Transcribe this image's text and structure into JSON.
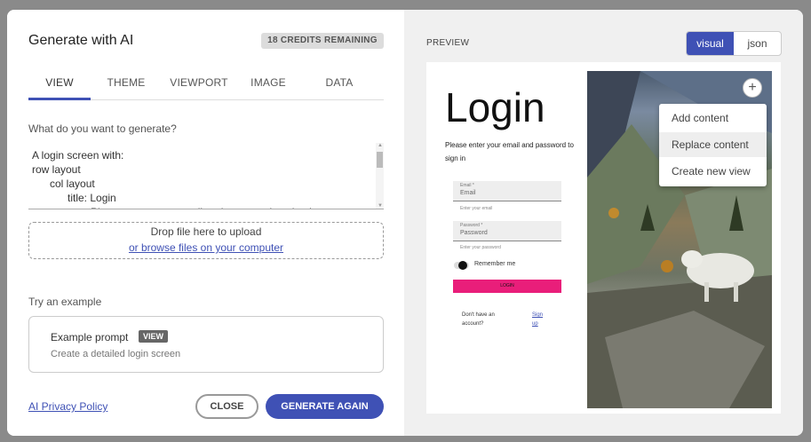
{
  "dialog": {
    "title": "Generate with AI",
    "credits": "18 CREDITS REMAINING",
    "tabs": [
      {
        "label": "VIEW"
      },
      {
        "label": "THEME"
      },
      {
        "label": "VIEWPORT"
      },
      {
        "label": "IMAGE"
      },
      {
        "label": "DATA"
      }
    ],
    "active_tab": "VIEW",
    "prompt_label": "What do you want to generate?",
    "prompt_value": "A login screen with:\nrow layout\n      col layout\n            title: Login\n            text: Please enter your email and password to sign in",
    "dropzone_text": "Drop file here to upload",
    "browse_link": "or browse files on your computer",
    "example_label": "Try an example",
    "example_title": "Example prompt",
    "example_badge": "VIEW",
    "example_desc": "Create a detailed login screen",
    "privacy_link": "AI Privacy Policy",
    "close_label": "CLOSE",
    "generate_label": "GENERATE AGAIN"
  },
  "preview": {
    "label": "PREVIEW",
    "toggle": [
      "visual",
      "json"
    ],
    "active_toggle": "visual",
    "login": {
      "heading": "Login",
      "subtitle": "Please enter your email and password to sign in",
      "email_label": "Email *",
      "email_placeholder": "Email",
      "email_hint": "Enter your email",
      "password_label": "Password *",
      "password_placeholder": "Password",
      "password_hint": "Enter your password",
      "remember": "Remember me",
      "login_button": "LOGIN",
      "no_account": "Don't have an account?",
      "signup": "Sign up"
    },
    "add_button": "+",
    "menu": [
      {
        "label": "Add content"
      },
      {
        "label": "Replace content"
      },
      {
        "label": "Create new view"
      }
    ],
    "hovered_menu_item": "Replace content"
  },
  "colors": {
    "accent": "#3f51b5",
    "login_button": "#e91e7a"
  }
}
